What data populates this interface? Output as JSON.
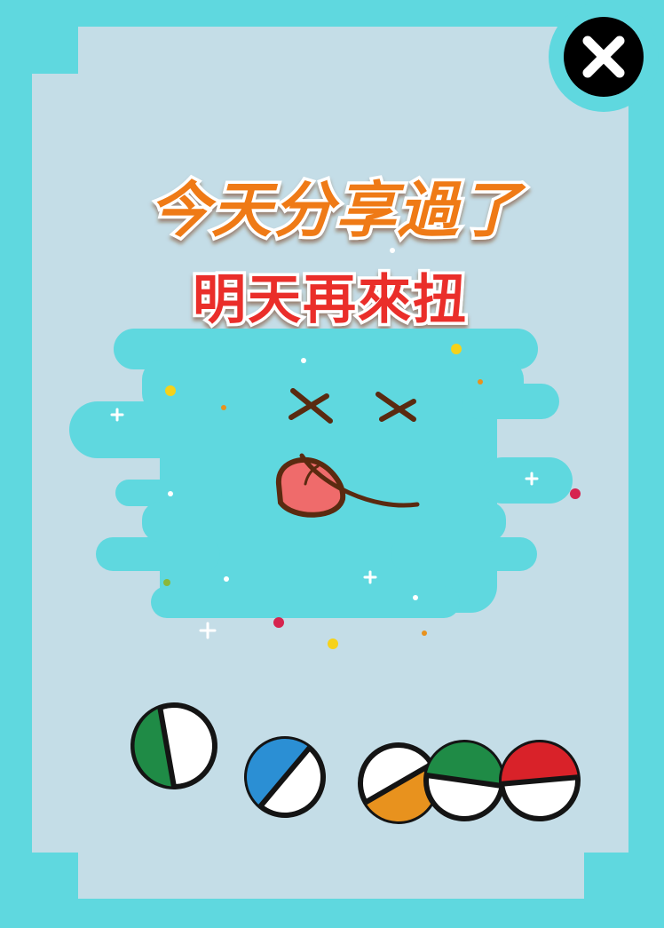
{
  "colors": {
    "outer_bg": "#5fd8df",
    "card_bg": "#c4dde7",
    "blob": "#5fd8df",
    "title_orange": "#ef7a12",
    "title_red": "#ea2e2a",
    "face_stroke": "#5a2a10",
    "tongue": "#ef6b6b",
    "capsule_green": "#1f8b46",
    "capsule_blue": "#2b8fd4",
    "capsule_orange": "#e8921e",
    "capsule_red": "#d92229"
  },
  "header": {
    "title": "今天分享過了",
    "subtitle": "明天再來扭"
  },
  "close_button": {
    "icon": "close-icon"
  },
  "mascot": {
    "icon": "dizzy-face-icon"
  },
  "capsules": [
    {
      "color": "#1f8b46"
    },
    {
      "color": "#2b8fd4"
    },
    {
      "color": "#e8921e"
    },
    {
      "color": "#1f8b46"
    },
    {
      "color": "#d92229"
    }
  ]
}
